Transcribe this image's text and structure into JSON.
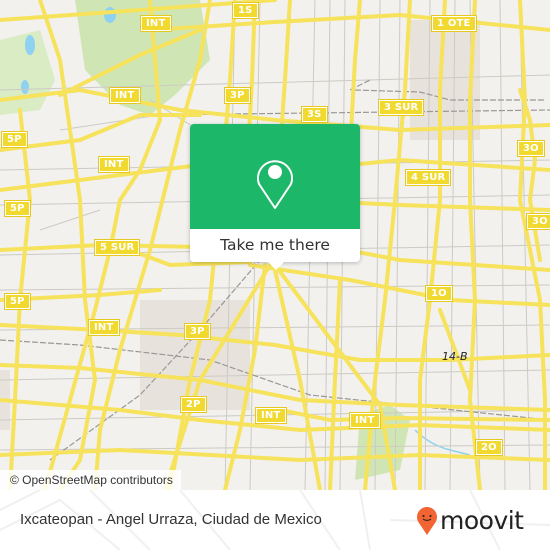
{
  "map": {
    "attribution": "© OpenStreetMap contributors",
    "colors": {
      "background": "#f2f1ee",
      "major_road": "#f6e25b",
      "minor_road": "#c9c6c0",
      "park": "#cfe6b4",
      "water": "#8ed1f0",
      "urban_block": "#e6dfd8"
    },
    "route_shields": [
      {
        "id": "int-1",
        "label": "INT"
      },
      {
        "id": "1s",
        "label": "1S"
      },
      {
        "id": "1-ote",
        "label": "1 OTE"
      },
      {
        "id": "3p-1",
        "label": "3P"
      },
      {
        "id": "int-2",
        "label": "INT"
      },
      {
        "id": "3s",
        "label": "3S"
      },
      {
        "id": "3-sur",
        "label": "3 SUR"
      },
      {
        "id": "5p-1",
        "label": "5P"
      },
      {
        "id": "int-3",
        "label": "INT"
      },
      {
        "id": "3o-1",
        "label": "3O"
      },
      {
        "id": "4-sur",
        "label": "4 SUR"
      },
      {
        "id": "5p-2",
        "label": "5P"
      },
      {
        "id": "3o-2",
        "label": "3O"
      },
      {
        "id": "5-sur",
        "label": "5 SUR"
      },
      {
        "id": "1o",
        "label": "1O"
      },
      {
        "id": "5p-3",
        "label": "5P"
      },
      {
        "id": "int-4",
        "label": "INT"
      },
      {
        "id": "3p-2",
        "label": "3P"
      },
      {
        "id": "2p",
        "label": "2P"
      },
      {
        "id": "int-5",
        "label": "INT"
      },
      {
        "id": "int-6",
        "label": "INT"
      },
      {
        "id": "2o",
        "label": "2O"
      }
    ],
    "road_labels": [
      {
        "id": "14-b",
        "label": "14-B"
      }
    ]
  },
  "popup": {
    "icon": "location-pin-icon",
    "button_label": "Take me there",
    "accent_color": "#1db76a"
  },
  "footer": {
    "title": "Ixcateopan - Angel Urraza, Ciudad de Mexico",
    "brand": "moovit",
    "brand_color": "#f26432"
  }
}
